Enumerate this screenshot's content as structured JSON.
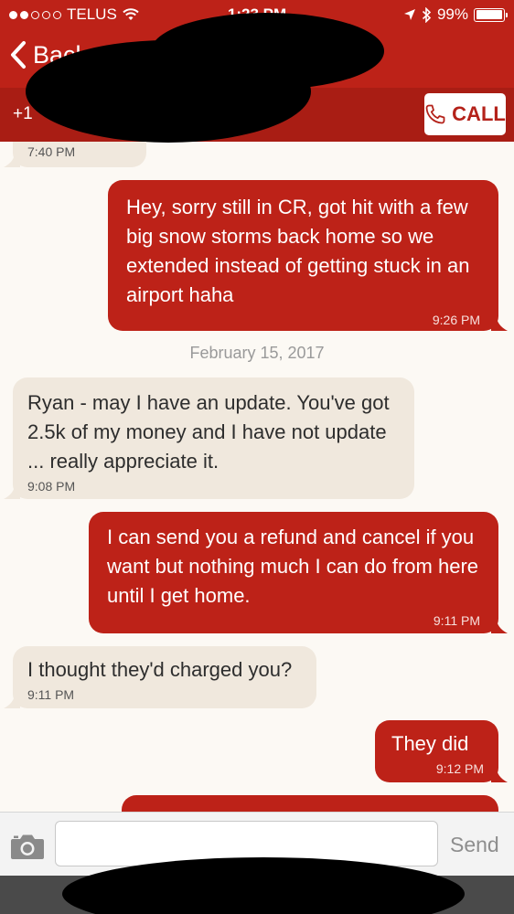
{
  "status_bar": {
    "carrier": "TELUS",
    "time": "1:23 PM",
    "battery": "99%",
    "signal_bars_filled": 2,
    "signal_bars_total": 5,
    "battery_level": 0.99
  },
  "nav": {
    "back_label": "Back"
  },
  "contact": {
    "phone_prefix": "+1",
    "call_label": "CALL"
  },
  "messages": [
    {
      "direction": "incoming",
      "text": "",
      "time": "7:40 PM"
    },
    {
      "direction": "outgoing",
      "text": "Hey, sorry still in CR, got hit with a few big snow storms back home so we extended instead of getting stuck in an airport haha",
      "time": "9:26 PM"
    },
    {
      "direction": "incoming",
      "text": "Ryan - may I have an update.  You've got 2.5k of my money and I have not update ... really appreciate it.",
      "time": "9:08 PM"
    },
    {
      "direction": "outgoing",
      "text": "I can send you a refund and cancel if you want but nothing much I can do from here until I get home.",
      "time": "9:11 PM"
    },
    {
      "direction": "incoming",
      "text": "I thought they'd charged you?",
      "time": "9:11 PM"
    },
    {
      "direction": "outgoing",
      "text": "They did",
      "time": "9:12 PM"
    }
  ],
  "date_separator": "February 15, 2017",
  "composer": {
    "placeholder": "",
    "send_label": "Send"
  },
  "icons": {
    "back": "chevron-left-icon",
    "call": "phone-icon",
    "camera": "camera-icon",
    "wifi": "wifi-icon",
    "location": "location-arrow-icon",
    "bluetooth": "bluetooth-icon",
    "battery": "battery-icon"
  },
  "colors": {
    "brand_red": "#bd2218",
    "brand_red_dark": "#a91d14",
    "incoming_bubble": "#f0e8dd",
    "background": "#fcf9f4"
  }
}
